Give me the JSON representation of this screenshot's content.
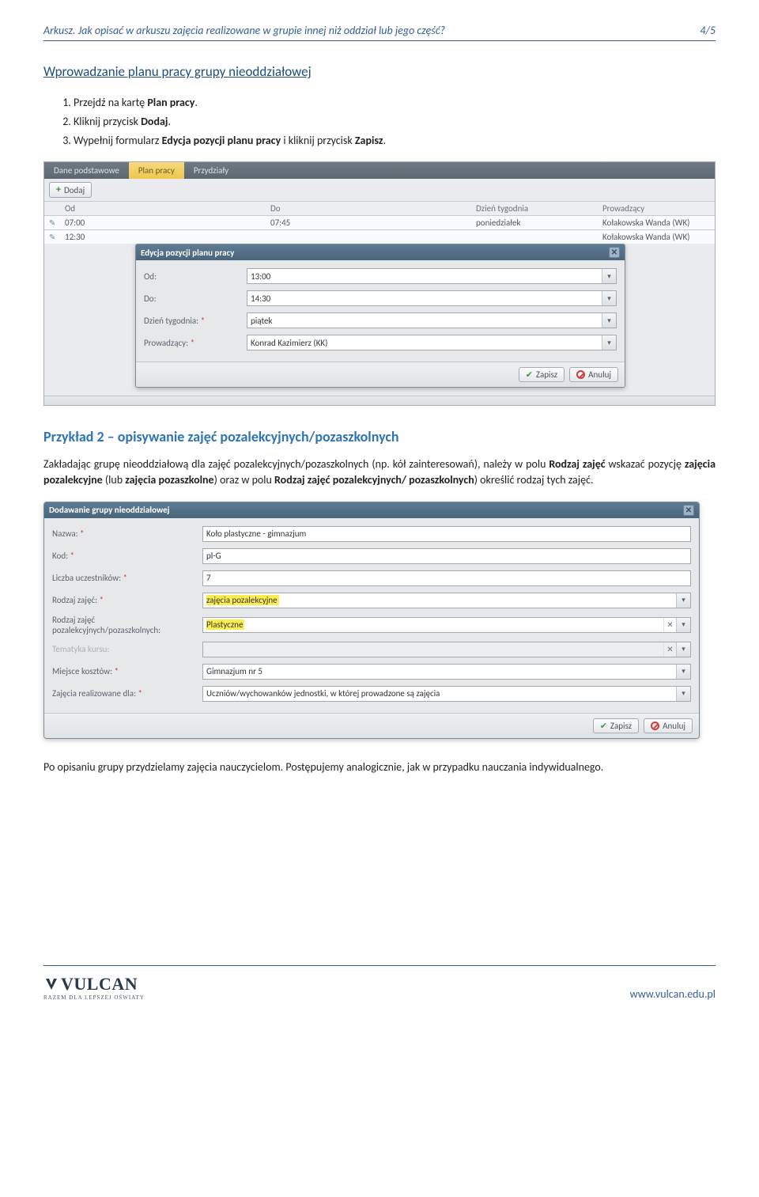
{
  "header": {
    "title": "Arkusz. Jak opisać w arkuszu zajęcia realizowane w grupie innej niż oddział lub jego część?",
    "page": "4/5"
  },
  "section_title": "Wprowadzanie planu pracy grupy nieoddziałowej",
  "steps": [
    {
      "pre": "Przejdź na kartę ",
      "bold": "Plan pracy",
      "post": "."
    },
    {
      "pre": "Kliknij przycisk ",
      "bold": "Dodaj",
      "post": "."
    },
    {
      "pre": "Wypełnij formularz ",
      "bold": "Edycja pozycji planu pracy",
      "post": " i kliknij przycisk ",
      "bold2": "Zapisz",
      "post2": "."
    }
  ],
  "shot1": {
    "tabs": [
      "Dane podstawowe",
      "Plan pracy",
      "Przydziały"
    ],
    "active_tab": 1,
    "add_btn": "Dodaj",
    "columns": [
      "",
      "Od",
      "Do",
      "Dzień tygodnia",
      "Prowadzący"
    ],
    "rows": [
      {
        "od": "07:00",
        "do": "07:45",
        "dzien": "poniedziałek",
        "prow": "Kołakowska Wanda (WK)"
      },
      {
        "od": "12:30",
        "do": "",
        "dzien": "",
        "prow": "Kołakowska Wanda (WK)"
      }
    ],
    "dialog": {
      "title": "Edycja pozycji planu pracy",
      "fields": {
        "od_label": "Od:",
        "od_value": "13:00",
        "do_label": "Do:",
        "do_value": "14:30",
        "dzien_label": "Dzień tygodnia:",
        "dzien_value": "piątek",
        "prow_label": "Prowadzący:",
        "prow_value": "Konrad Kazimierz (KK)"
      },
      "save": "Zapisz",
      "cancel": "Anuluj"
    }
  },
  "example2": {
    "heading": "Przykład 2 – opisywanie zajęć pozalekcyjnych/pozaszkolnych",
    "para_html": "Zakładając grupę nieoddziałową dla zajęć pozalekcyjnych/pozaszkolnych (np. kół zainteresowań), należy w polu <b>Rodzaj zajęć</b> wskazać pozycję <b>zajęcia pozalekcyjne</b> (lub <b>zajęcia pozaszkolne</b>) oraz w polu <b>Rodzaj zajęć pozalekcyjnych/ pozaszkolnych</b>) określić rodzaj tych zajęć."
  },
  "shot2": {
    "title": "Dodawanie grupy nieoddziałowej",
    "fields": {
      "nazwa_label": "Nazwa:",
      "nazwa_value": "Koło plastyczne - gimnazjum",
      "kod_label": "Kod:",
      "kod_value": "pl-G",
      "liczba_label": "Liczba uczestników:",
      "liczba_value": "7",
      "rodzaj_label": "Rodzaj zajęć:",
      "rodzaj_value": "zajęcia pozalekcyjne",
      "rodzajpoz_label": "Rodzaj zajęć pozalekcyjnych/pozaszkolnych:",
      "rodzajpoz_value": "Plastyczne",
      "temat_label": "Tematyka kursu:",
      "temat_value": "",
      "miejsce_label": "Miejsce kosztów:",
      "miejsce_value": "Gimnazjum nr 5",
      "realiz_label": "Zajęcia realizowane dla:",
      "realiz_value": "Uczniów/wychowanków jednostki, w której prowadzone są zajęcia"
    },
    "save": "Zapisz",
    "cancel": "Anuluj"
  },
  "after_text": "Po opisaniu grupy przydzielamy zajęcia nauczycielom. Postępujemy analogicznie, jak w przypadku nauczania indywidualnego.",
  "footer": {
    "brand": "VULCAN",
    "slogan": "RAZEM DLA LEPSZEJ OŚWIATY",
    "url": "www.vulcan.edu.pl"
  }
}
